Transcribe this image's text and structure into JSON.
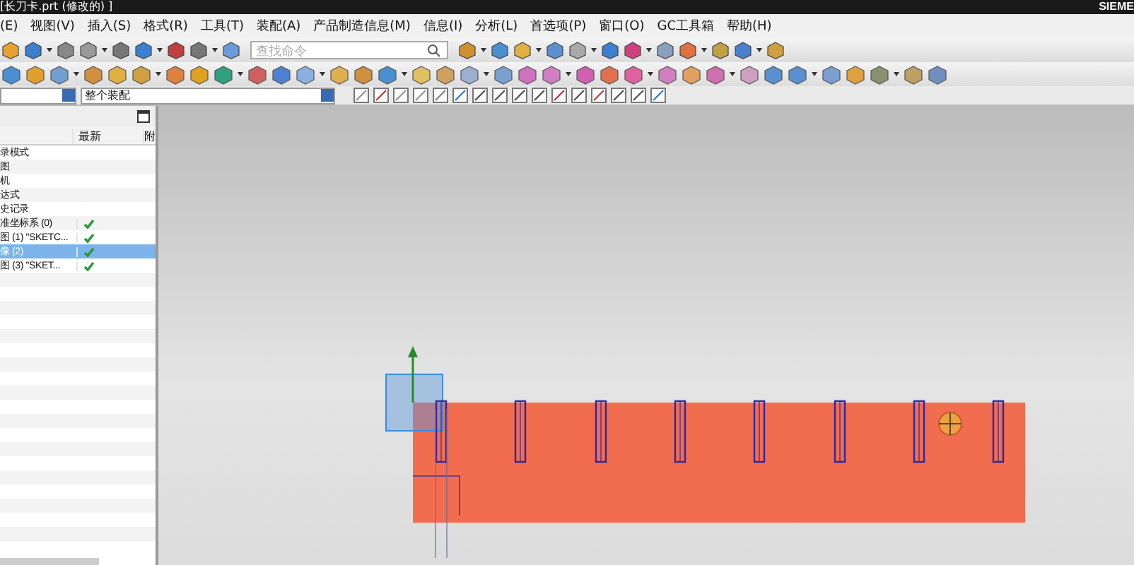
{
  "window": {
    "title": "[长刀卡.prt  (修改的)  ]",
    "brand": "SIEME"
  },
  "menu": [
    "(E)",
    "视图(V)",
    "插入(S)",
    "格式(R)",
    "工具(T)",
    "装配(A)",
    "产品制造信息(M)",
    "信息(I)",
    "分析(L)",
    "首选项(P)",
    "窗口(O)",
    "GC工具箱",
    "帮助(H)"
  ],
  "search": {
    "placeholder": "查找命令"
  },
  "selection_bar": {
    "scope": "整个装配"
  },
  "navigator": {
    "columns": [
      "最新",
      "附"
    ],
    "rows": [
      {
        "name": "录模式",
        "checked": false,
        "selected": false
      },
      {
        "name": "图",
        "checked": false,
        "selected": false
      },
      {
        "name": "机",
        "checked": false,
        "selected": false
      },
      {
        "name": "达式",
        "checked": false,
        "selected": false
      },
      {
        "name": "史记录",
        "checked": false,
        "selected": false
      },
      {
        "name": "准坐标系 (0)",
        "checked": true,
        "selected": false
      },
      {
        "name": "图 (1) \"SKETC...",
        "checked": true,
        "selected": false
      },
      {
        "name": "像 (2)",
        "checked": true,
        "selected": true
      },
      {
        "name": "图 (3) \"SKET...",
        "checked": true,
        "selected": false
      }
    ]
  }
}
